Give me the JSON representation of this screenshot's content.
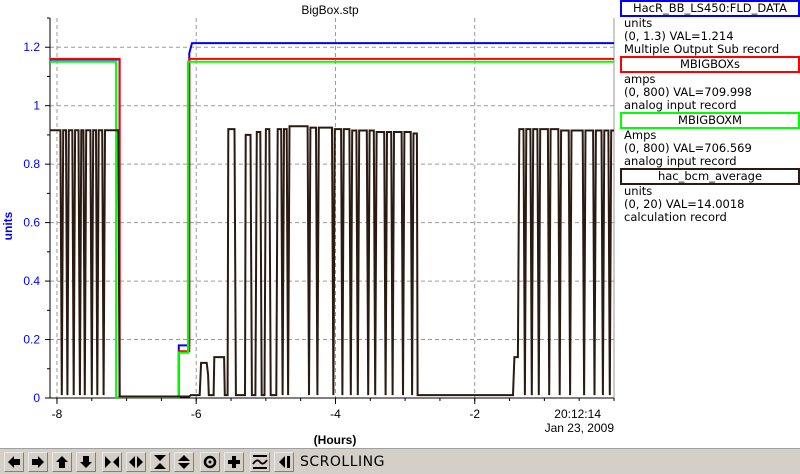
{
  "chart_data": {
    "type": "line",
    "title": "BigBox.stp",
    "ylabel": "units",
    "xlabel": "(Hours)",
    "xlim": [
      -8.1,
      0
    ],
    "ylim": [
      0,
      1.3
    ],
    "x_ticks": [
      -8,
      -6,
      -4,
      -2
    ],
    "x_tick_labels": [
      "-8",
      "-6",
      "-4",
      "-2"
    ],
    "y_ticks": [
      0,
      0.2,
      0.4,
      0.6,
      0.8,
      1.0,
      1.2
    ],
    "y_tick_labels": [
      "0",
      "0.2",
      "0.4",
      "0.6",
      "0.8",
      "1",
      "1.2"
    ],
    "end_time": "20:12:14",
    "end_date": "Jan 23, 2009",
    "grid": true,
    "series": [
      {
        "name": "HacR_BB_LS450:FLD_DATA",
        "color": "#0000ff",
        "width": 2,
        "points": [
          [
            -8.1,
            1.158
          ],
          [
            -7.1,
            1.158
          ],
          [
            -7.1,
            0.005
          ],
          [
            -6.25,
            0.005
          ],
          [
            -6.25,
            0.18
          ],
          [
            -6.1,
            0.18
          ],
          [
            -6.1,
            1.18
          ],
          [
            -6.06,
            1.214
          ],
          [
            0,
            1.214
          ]
        ]
      },
      {
        "name": "MBIGBOXs",
        "color": "#ff0000",
        "width": 2,
        "points": [
          [
            -8.1,
            1.16
          ],
          [
            -7.1,
            1.16
          ],
          [
            -7.1,
            0.005
          ],
          [
            -6.25,
            0.005
          ],
          [
            -6.25,
            0.16
          ],
          [
            -6.1,
            0.16
          ],
          [
            -6.1,
            1.16
          ],
          [
            0,
            1.16
          ]
        ]
      },
      {
        "name": "MBIGBOXM",
        "color": "#00ff00",
        "width": 2,
        "points": [
          [
            -8.1,
            1.15
          ],
          [
            -7.15,
            1.15
          ],
          [
            -7.15,
            0.003
          ],
          [
            -6.25,
            0.003
          ],
          [
            -6.25,
            0.155
          ],
          [
            -6.12,
            0.155
          ],
          [
            -6.12,
            1.15
          ],
          [
            0,
            1.15
          ]
        ]
      },
      {
        "name": "hac_bcm_average",
        "color": "#2b1a10",
        "width": 2,
        "points": [
          [
            -8.1,
            0.916
          ],
          [
            -7.95,
            0.916
          ],
          [
            -7.93,
            0.01
          ],
          [
            -7.91,
            0.916
          ],
          [
            -7.87,
            0.916
          ],
          [
            -7.85,
            0.01
          ],
          [
            -7.83,
            0.916
          ],
          [
            -7.78,
            0.916
          ],
          [
            -7.76,
            0.01
          ],
          [
            -7.74,
            0.916
          ],
          [
            -7.69,
            0.916
          ],
          [
            -7.67,
            0.01
          ],
          [
            -7.65,
            0.916
          ],
          [
            -7.62,
            0.916
          ],
          [
            -7.6,
            0.01
          ],
          [
            -7.58,
            0.916
          ],
          [
            -7.52,
            0.916
          ],
          [
            -7.5,
            0.01
          ],
          [
            -7.48,
            0.916
          ],
          [
            -7.44,
            0.916
          ],
          [
            -7.42,
            0.01
          ],
          [
            -7.4,
            0.916
          ],
          [
            -7.35,
            0.916
          ],
          [
            -7.33,
            0.01
          ],
          [
            -7.31,
            0.916
          ],
          [
            -7.12,
            0.916
          ],
          [
            -7.1,
            0.005
          ],
          [
            -6.1,
            0.005
          ],
          [
            -6.08,
            0.01
          ],
          [
            -5.95,
            0.01
          ],
          [
            -5.93,
            0.12
          ],
          [
            -5.85,
            0.12
          ],
          [
            -5.83,
            0.08
          ],
          [
            -5.82,
            0.01
          ],
          [
            -5.75,
            0.01
          ],
          [
            -5.74,
            0.14
          ],
          [
            -5.6,
            0.14
          ],
          [
            -5.59,
            0.01
          ],
          [
            -5.55,
            0.01
          ],
          [
            -5.54,
            0.92
          ],
          [
            -5.45,
            0.92
          ],
          [
            -5.43,
            0.01
          ],
          [
            -5.3,
            0.01
          ],
          [
            -5.29,
            0.9
          ],
          [
            -5.22,
            0.9
          ],
          [
            -5.2,
            0.01
          ],
          [
            -5.15,
            0.01
          ],
          [
            -5.13,
            0.91
          ],
          [
            -5.08,
            0.91
          ],
          [
            -5.06,
            0.01
          ],
          [
            -5.02,
            0.01
          ],
          [
            -5.0,
            0.92
          ],
          [
            -4.95,
            0.92
          ],
          [
            -4.93,
            0.01
          ],
          [
            -4.85,
            0.01
          ],
          [
            -4.83,
            0.92
          ],
          [
            -4.78,
            0.92
          ],
          [
            -4.76,
            0.01
          ],
          [
            -4.74,
            0.92
          ],
          [
            -4.7,
            0.92
          ],
          [
            -4.68,
            0.01
          ],
          [
            -4.66,
            0.93
          ],
          [
            -4.4,
            0.93
          ],
          [
            -4.38,
            0.01
          ],
          [
            -4.36,
            0.925
          ],
          [
            -4.28,
            0.925
          ],
          [
            -4.26,
            0.01
          ],
          [
            -4.24,
            0.925
          ],
          [
            -4.05,
            0.925
          ],
          [
            -4.03,
            0.01
          ],
          [
            -4.01,
            0.92
          ],
          [
            -3.92,
            0.92
          ],
          [
            -3.9,
            0.01
          ],
          [
            -3.88,
            0.92
          ],
          [
            -3.8,
            0.92
          ],
          [
            -3.78,
            0.01
          ],
          [
            -3.76,
            0.915
          ],
          [
            -3.7,
            0.915
          ],
          [
            -3.68,
            0.01
          ],
          [
            -3.66,
            0.915
          ],
          [
            -3.55,
            0.915
          ],
          [
            -3.53,
            0.01
          ],
          [
            -3.51,
            0.915
          ],
          [
            -3.45,
            0.915
          ],
          [
            -3.43,
            0.01
          ],
          [
            -3.41,
            0.91
          ],
          [
            -3.3,
            0.91
          ],
          [
            -3.28,
            0.01
          ],
          [
            -3.26,
            0.91
          ],
          [
            -3.2,
            0.91
          ],
          [
            -3.18,
            0.01
          ],
          [
            -3.16,
            0.91
          ],
          [
            -3.05,
            0.91
          ],
          [
            -3.03,
            0.01
          ],
          [
            -3.01,
            0.91
          ],
          [
            -2.92,
            0.91
          ],
          [
            -2.9,
            0.01
          ],
          [
            -2.88,
            0.905
          ],
          [
            -2.83,
            0.905
          ],
          [
            -2.82,
            0.01
          ],
          [
            -1.45,
            0.01
          ],
          [
            -1.43,
            0.14
          ],
          [
            -1.38,
            0.14
          ],
          [
            -1.36,
            0.92
          ],
          [
            -1.3,
            0.92
          ],
          [
            -1.28,
            0.01
          ],
          [
            -1.26,
            0.92
          ],
          [
            -1.2,
            0.92
          ],
          [
            -1.18,
            0.01
          ],
          [
            -1.16,
            0.92
          ],
          [
            -1.1,
            0.92
          ],
          [
            -1.08,
            0.01
          ],
          [
            -1.06,
            0.92
          ],
          [
            -0.95,
            0.92
          ],
          [
            -0.93,
            0.01
          ],
          [
            -0.91,
            0.92
          ],
          [
            -0.8,
            0.92
          ],
          [
            -0.78,
            0.01
          ],
          [
            -0.76,
            0.915
          ],
          [
            -0.65,
            0.915
          ],
          [
            -0.63,
            0.01
          ],
          [
            -0.61,
            0.915
          ],
          [
            -0.45,
            0.915
          ],
          [
            -0.43,
            0.01
          ],
          [
            -0.41,
            0.915
          ],
          [
            -0.3,
            0.915
          ],
          [
            -0.28,
            0.01
          ],
          [
            -0.26,
            0.915
          ],
          [
            -0.18,
            0.915
          ],
          [
            -0.16,
            0.01
          ],
          [
            -0.14,
            0.915
          ],
          [
            -0.08,
            0.915
          ],
          [
            -0.06,
            0.01
          ],
          [
            -0.04,
            0.915
          ],
          [
            0,
            0.915
          ]
        ]
      }
    ]
  },
  "legend": [
    {
      "name": "HacR_BB_LS450:FLD_DATA",
      "color": "#0000ff",
      "units": "units",
      "range": "(0, 1.3) VAL=1.214",
      "record": "Multiple Output Sub record"
    },
    {
      "name": "MBIGBOXs",
      "color": "#ff0000",
      "units": "amps",
      "range": "(0, 800) VAL=709.998",
      "record": "analog input record"
    },
    {
      "name": "MBIGBOXM",
      "color": "#00ff00",
      "units": "Amps",
      "range": "(0, 800) VAL=706.569",
      "record": "analog input record"
    },
    {
      "name": "hac_bcm_average",
      "color": "#2b1a10",
      "units": "units",
      "range": "(0, 20) VAL=14.0018",
      "record": "calculation record"
    }
  ],
  "toolbar": {
    "buttons": [
      {
        "name": "scroll-left-button",
        "icon": "arrow-left-icon"
      },
      {
        "name": "scroll-right-button",
        "icon": "arrow-right-icon"
      },
      {
        "name": "scroll-up-button",
        "icon": "arrow-up-icon"
      },
      {
        "name": "scroll-down-button",
        "icon": "arrow-down-icon"
      },
      {
        "name": "compress-horizontal-button",
        "icon": "compress-horizontal-icon"
      },
      {
        "name": "expand-horizontal-button",
        "icon": "expand-horizontal-icon"
      },
      {
        "name": "compress-vertical-button",
        "icon": "compress-vertical-icon"
      },
      {
        "name": "expand-vertical-button",
        "icon": "expand-vertical-icon"
      },
      {
        "name": "zoom-button",
        "icon": "zoom-icon"
      },
      {
        "name": "cross-button",
        "icon": "plus-icon"
      },
      {
        "name": "autoscale-button",
        "icon": "autoscale-icon"
      },
      {
        "name": "scroll-mode-button",
        "icon": "scroll-mode-icon"
      }
    ],
    "mode_label": "SCROLLING"
  }
}
